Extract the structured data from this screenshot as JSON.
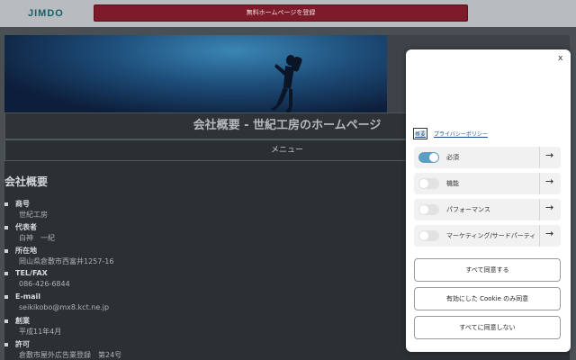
{
  "topbar": {
    "logo": "JIMDO",
    "register_button": "無料ホームページを登録"
  },
  "site": {
    "title": "会社概要 - 世紀工房のホームページ",
    "menu_label": "メニュー"
  },
  "content": {
    "heading": "会社概要",
    "items": [
      {
        "label": "商号",
        "value": "世紀工房"
      },
      {
        "label": "代表者",
        "value": "白神　一紀"
      },
      {
        "label": "所在地",
        "value": "岡山県倉敷市西富井1257-16"
      },
      {
        "label": "TEL/FAX",
        "value": "086-426-6844"
      },
      {
        "label": "E-mail",
        "value": "seikikobo@mx8.kct.ne.jp"
      },
      {
        "label": "創業",
        "value": "平成11年4月"
      },
      {
        "label": "許可",
        "value": "倉敷市屋外広告業登録　第24号"
      }
    ]
  },
  "cookie": {
    "close": "x",
    "links": {
      "overview": "概要",
      "privacy": "プライバシーポリシー"
    },
    "options": [
      {
        "label": "必須",
        "enabled": true
      },
      {
        "label": "機能",
        "enabled": false
      },
      {
        "label": "パフォーマンス",
        "enabled": false
      },
      {
        "label": "マーケティング/サードパーティ",
        "enabled": false
      }
    ],
    "arrow_glyph": "→",
    "buttons": {
      "accept_all": "すべて同意する",
      "accept_selected": "有効にした Cookie のみ同意",
      "reject_all": "すべてに同意しない"
    }
  },
  "colors": {
    "register_bg": "#7e1b2b",
    "toggle_on": "#5b9ec4",
    "page_bg": "#2c3034"
  }
}
